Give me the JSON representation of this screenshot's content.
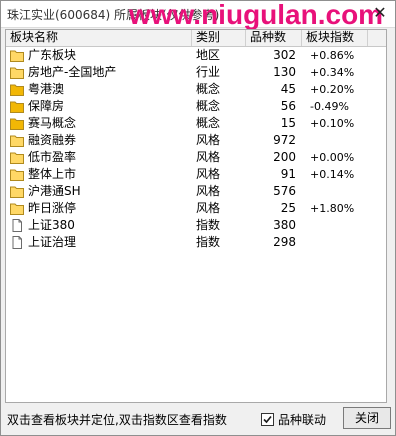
{
  "window": {
    "title": "珠江实业(600684) 所属板块(仅供参考)",
    "watermark": "www.niugulan.com",
    "close_glyph": "✕"
  },
  "table": {
    "columns": [
      "板块名称",
      "类别",
      "品种数",
      "板块指数"
    ],
    "rows": [
      {
        "name": "广东板块",
        "type": "地区",
        "count": "302",
        "pct": "+0.86%",
        "icon": "folder-icon"
      },
      {
        "name": "房地产-全国地产",
        "type": "行业",
        "count": "130",
        "pct": "+0.34%",
        "icon": "folder-icon"
      },
      {
        "name": "粤港澳",
        "type": "概念",
        "count": "45",
        "pct": "+0.20%",
        "icon": "folder-filled-icon"
      },
      {
        "name": "保障房",
        "type": "概念",
        "count": "56",
        "pct": "-0.49%",
        "icon": "folder-filled-icon"
      },
      {
        "name": "赛马概念",
        "type": "概念",
        "count": "15",
        "pct": "+0.10%",
        "icon": "folder-filled-icon"
      },
      {
        "name": "融资融券",
        "type": "风格",
        "count": "972",
        "pct": "",
        "icon": "folder-icon"
      },
      {
        "name": "低市盈率",
        "type": "风格",
        "count": "200",
        "pct": "+0.00%",
        "icon": "folder-icon"
      },
      {
        "name": "整体上市",
        "type": "风格",
        "count": "91",
        "pct": "+0.14%",
        "icon": "folder-icon"
      },
      {
        "name": "沪港通SH",
        "type": "风格",
        "count": "576",
        "pct": "",
        "icon": "folder-icon"
      },
      {
        "name": "昨日涨停",
        "type": "风格",
        "count": "25",
        "pct": "+1.80%",
        "icon": "folder-icon"
      },
      {
        "name": "上证380",
        "type": "指数",
        "count": "380",
        "pct": "",
        "icon": "document-icon"
      },
      {
        "name": "上证治理",
        "type": "指数",
        "count": "298",
        "pct": "",
        "icon": "document-icon"
      }
    ]
  },
  "footer": {
    "hint": "双击查看板块并定位,双击指数区查看指数",
    "linkage_label": "品种联动",
    "linkage_checked": true,
    "close_label": "关闭"
  },
  "colors": {
    "watermark": "#e8117a",
    "folder_fill": "#ffd866",
    "folder_filled": "#f2b705",
    "folder_stroke": "#b08a1e"
  }
}
